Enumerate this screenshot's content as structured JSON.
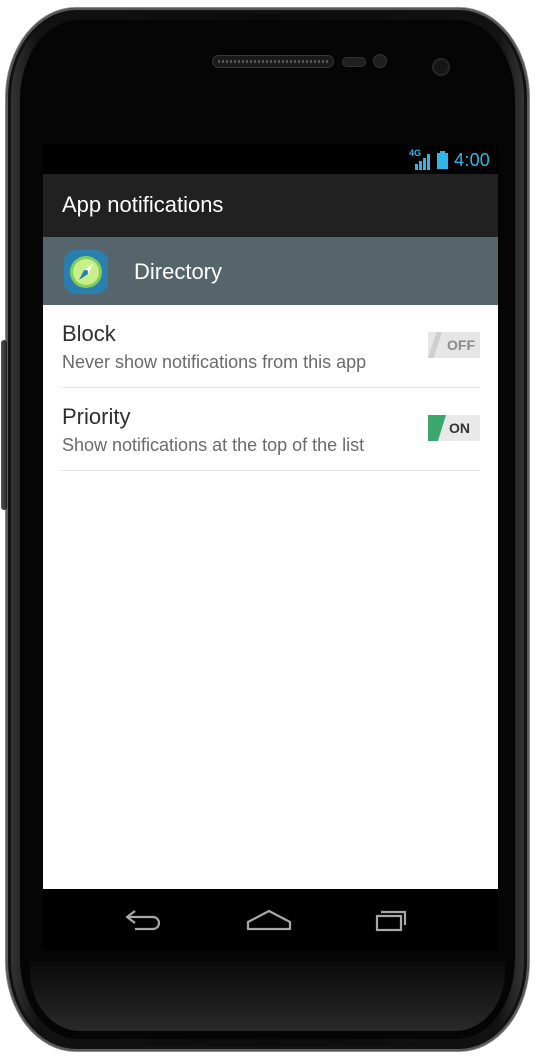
{
  "status_bar": {
    "network_label": "4G",
    "time": "4:00",
    "accent_color": "#33b5e5"
  },
  "action_bar": {
    "title": "App notifications"
  },
  "app": {
    "name": "Directory",
    "icon": "compass-icon"
  },
  "settings": [
    {
      "title": "Block",
      "summary": "Never show notifications from this app",
      "toggle_label": "OFF",
      "enabled": false
    },
    {
      "title": "Priority",
      "summary": "Show notifications at the top of the list",
      "toggle_label": "ON",
      "enabled": true
    }
  ],
  "nav_bar": {
    "buttons": [
      "back-icon",
      "home-icon",
      "recent-apps-icon"
    ]
  },
  "colors": {
    "action_bar": "#212121",
    "app_header": "#56646c",
    "toggle_on": "#3aa76d"
  }
}
